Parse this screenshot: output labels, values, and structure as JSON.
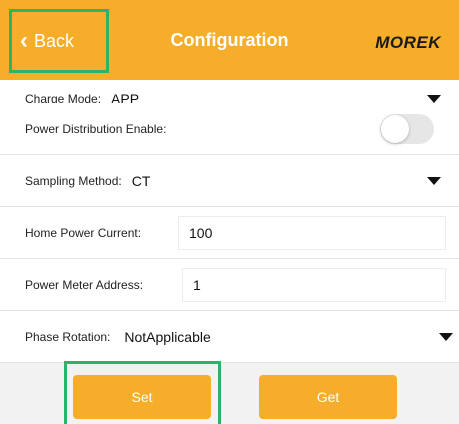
{
  "header": {
    "back_label": "Back",
    "title": "Configuration",
    "logo": "MOREK",
    "color": "#f5ad2a"
  },
  "fields": {
    "charge_mode": {
      "label": "Charge Mode:",
      "value": "APP"
    },
    "power_distribution": {
      "label": "Power Distribution Enable:",
      "enabled": false
    },
    "sampling_method": {
      "label": "Sampling Method:",
      "value": "CT"
    },
    "home_power_current": {
      "label": "Home Power Current:",
      "value": "100"
    },
    "power_meter_address": {
      "label": "Power Meter Address:",
      "value": "1"
    },
    "phase_rotation": {
      "label": "Phase Rotation:",
      "value": "NotApplicable"
    }
  },
  "buttons": {
    "set_label": "Set",
    "get_label": "Get"
  },
  "icons": {
    "back": "chevron-left-icon",
    "dropdown": "caret-down-icon"
  },
  "colors": {
    "accent": "#f5ad2a",
    "highlight": "#2bb36a"
  }
}
